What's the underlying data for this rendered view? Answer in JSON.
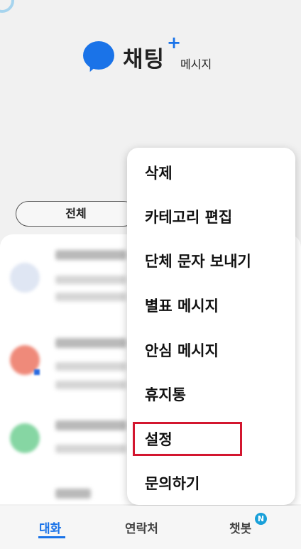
{
  "app": {
    "name": "채팅",
    "plus": "+",
    "subtitle": "메시지"
  },
  "filter": {
    "selected": "전체"
  },
  "menu": {
    "items": [
      "삭제",
      "카테고리 편집",
      "단체 문자 보내기",
      "별표 메시지",
      "안심 메시지",
      "휴지통",
      "설정",
      "문의하기"
    ],
    "highlighted": "설정"
  },
  "tabs": [
    {
      "label": "대화",
      "active": true
    },
    {
      "label": "연락처",
      "active": false
    },
    {
      "label": "챗봇",
      "active": false,
      "badge": "N"
    }
  ],
  "colors": {
    "accent": "#1a73e8",
    "highlight": "#d3162f",
    "badge": "#19a0d9"
  }
}
